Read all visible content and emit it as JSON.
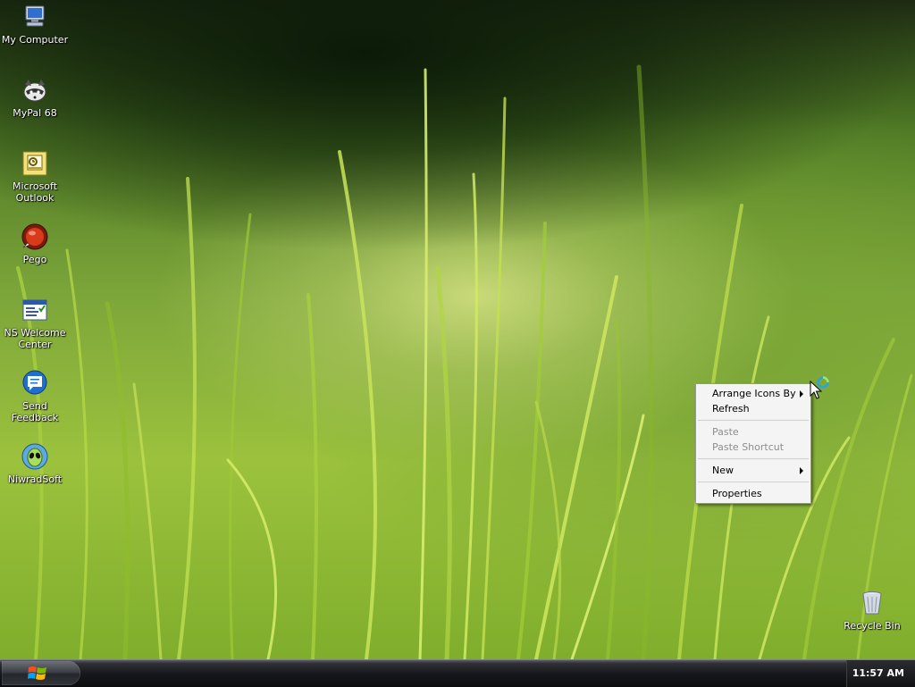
{
  "desktop": {
    "icons": [
      {
        "label": "My Computer",
        "icon": "computer-icon"
      },
      {
        "label": "MyPal 68",
        "icon": "raccoon-icon"
      },
      {
        "label": "Microsoft Outlook",
        "icon": "outlook-icon"
      },
      {
        "label": "Pego",
        "icon": "pego-icon"
      },
      {
        "label": "NS Welcome Center",
        "icon": "welcome-center-icon"
      },
      {
        "label": "Send Feedback",
        "icon": "feedback-icon"
      },
      {
        "label": "NiwradSoft",
        "icon": "alien-icon"
      },
      {
        "label": "Recycle Bin",
        "icon": "recycle-bin-icon"
      }
    ]
  },
  "context_menu": {
    "items": [
      {
        "label": "Arrange Icons By",
        "submenu": true,
        "enabled": true
      },
      {
        "label": "Refresh",
        "submenu": false,
        "enabled": true
      },
      {
        "label": "Paste",
        "submenu": false,
        "enabled": false
      },
      {
        "label": "Paste Shortcut",
        "submenu": false,
        "enabled": false
      },
      {
        "label": "New",
        "submenu": true,
        "enabled": true
      },
      {
        "label": "Properties",
        "submenu": false,
        "enabled": true
      }
    ]
  },
  "taskbar": {
    "start_icon": "windows-logo-icon",
    "clock": "11:57 AM"
  },
  "colors": {
    "menu_background": "#f4f4f4",
    "menu_disabled_text": "#8d8d8d",
    "taskbar_dark": "#111214"
  }
}
